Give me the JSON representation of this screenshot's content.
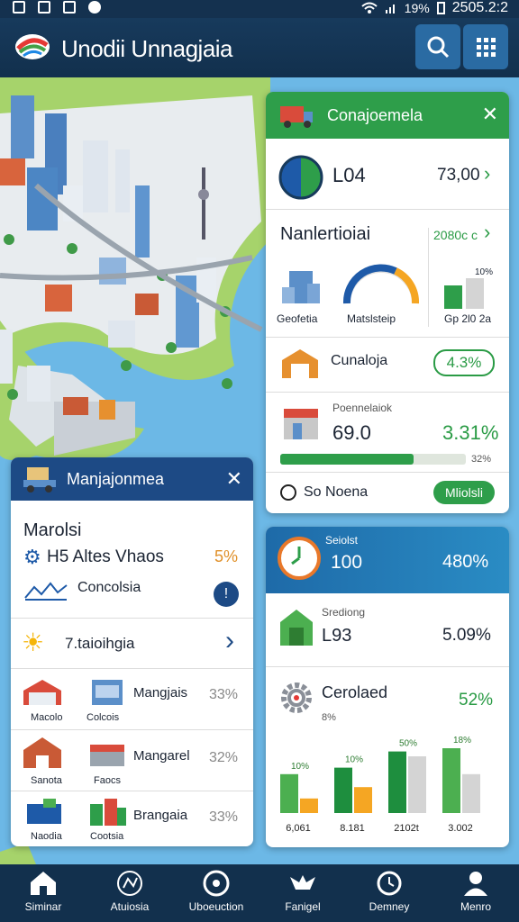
{
  "status": {
    "left_icons": [
      "image-icon",
      "grid-icon",
      "n-icon",
      "alert-icon"
    ],
    "battery": "19%",
    "time": "2505.2:2"
  },
  "app": {
    "title": "Unodii Unnagjaia",
    "search_icon": "search-icon",
    "grid_icon": "apps-grid-icon"
  },
  "right_card": {
    "title": "Conajoemela",
    "row1": {
      "label": "L04",
      "value": "73,00"
    },
    "section2": {
      "title": "Nanlertioiai",
      "link": "2080c c",
      "tiles": [
        "Geofetia",
        "Matslsteip",
        "Gp 2l0 2a"
      ],
      "bar_label_top": "10%"
    },
    "row3": {
      "label": "Cunaloja",
      "badge": "4.3%"
    },
    "section4": {
      "caption": "Poennelaiok",
      "value": "69.0",
      "percent": "3.31%",
      "progress_value": 0.72,
      "progress_label": "32%"
    },
    "row5": {
      "label": "So Noena",
      "button": "Mliolsli"
    }
  },
  "right_card2": {
    "header": {
      "caption": "Seiolst",
      "value": "100",
      "percent": "480%"
    },
    "row2": {
      "caption": "Srediong",
      "value": "L93",
      "percent": "5.09%"
    },
    "row3": {
      "title": "Cerolaed",
      "sub": "8%",
      "percent": "52%"
    },
    "chart_data": {
      "type": "bar",
      "categories": [
        "6,061",
        "8.181",
        "2102t",
        "3.002"
      ],
      "series": [
        {
          "values": [
            48,
            56,
            76,
            80
          ]
        },
        {
          "values": [
            18,
            32,
            70,
            48
          ]
        }
      ],
      "labels": [
        "10%",
        "10%",
        "50%",
        "18%"
      ],
      "colors": {
        "a": "#4caf50",
        "b": "#f5a623",
        "c": "#1e8e3e",
        "d": "#d4d4d4"
      }
    }
  },
  "left_card": {
    "title": "Manjajonmea",
    "heading": "Marolsi",
    "item1": {
      "label": "H5 Altes Vhaos",
      "value": "5%"
    },
    "item2": {
      "label": "Concolsia"
    },
    "item3": {
      "label": "7.taioihgia"
    },
    "grid": [
      {
        "a": "Macolo",
        "b": "Colcois",
        "name": "Mangjais",
        "pct": "33%"
      },
      {
        "a": "Sanota",
        "b": "Faocs",
        "name": "Mangarel",
        "pct": "32%"
      },
      {
        "a": "Naodia",
        "b": "Cootsia",
        "name": "Brangaia",
        "pct": "33%"
      }
    ]
  },
  "nav": [
    {
      "label": "Siminar",
      "icon": "home-icon"
    },
    {
      "label": "Atuiosia",
      "icon": "route-icon"
    },
    {
      "label": "Uboeuction",
      "icon": "compass-icon"
    },
    {
      "label": "Fanigel",
      "icon": "bird-icon"
    },
    {
      "label": "Demney",
      "icon": "clock-icon"
    },
    {
      "label": "Menro",
      "icon": "person-icon"
    }
  ]
}
